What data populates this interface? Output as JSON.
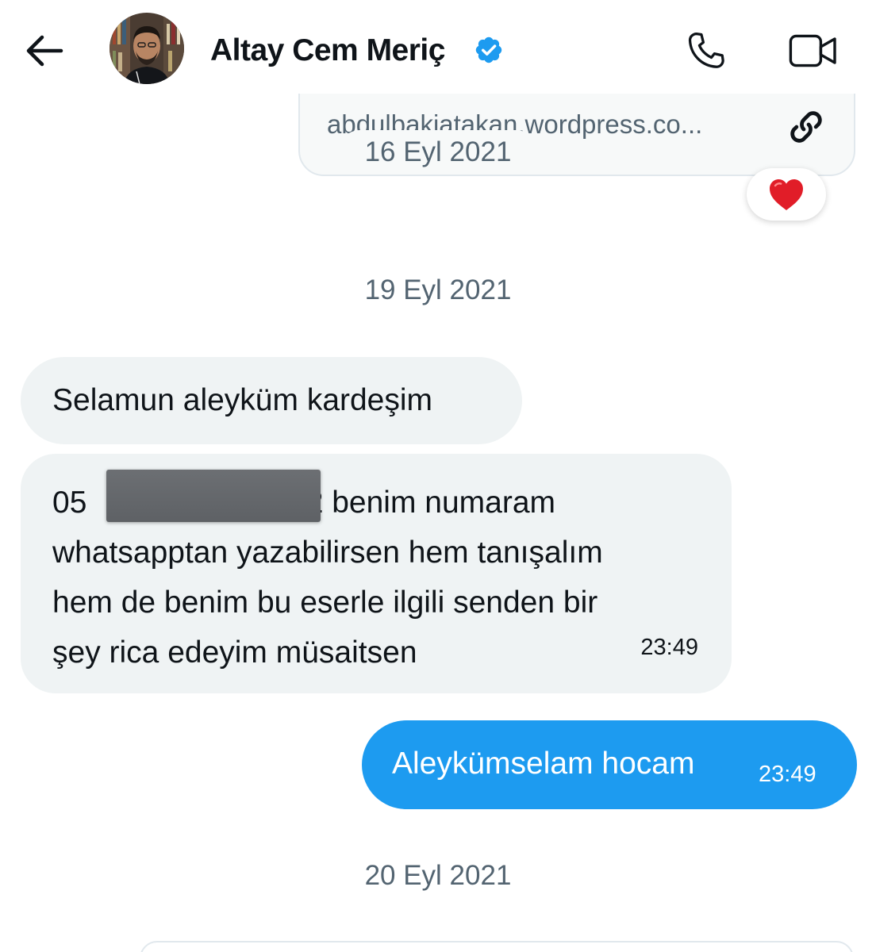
{
  "header": {
    "contact_name": "Altay Cem Meriç",
    "verified": true,
    "icons": {
      "back": "back-arrow-icon",
      "call": "phone-icon",
      "video": "video-camera-icon",
      "verified": "verified-badge-icon"
    }
  },
  "link_card": {
    "url": "abdulbakiatakan.wordpress.co...",
    "icon": "link-icon"
  },
  "dates": {
    "first": "16 Eyl 2021",
    "second": "19 Eyl 2021",
    "third": "20 Eyl 2021"
  },
  "reaction": {
    "emoji": "❤️"
  },
  "messages": [
    {
      "direction": "incoming",
      "text": "Selamun aleyküm kardeşim"
    },
    {
      "direction": "incoming",
      "phone_prefix": "05",
      "phone_suffix": "2",
      "lines": [
        " benim numaram",
        "whatsapptan yazabilirsen hem tanışalım",
        "hem de benim bu eserle ilgili senden bir",
        "şey rica edeyim müsaitsen"
      ],
      "time": "23:49"
    },
    {
      "direction": "outgoing",
      "text": "Aleykümselam hocam",
      "time": "23:49"
    }
  ],
  "colors": {
    "outgoing_bubble": "#1d9bf0",
    "incoming_bubble": "#eff3f4",
    "secondary_text": "#536471",
    "verified": "#1d9bf0"
  }
}
